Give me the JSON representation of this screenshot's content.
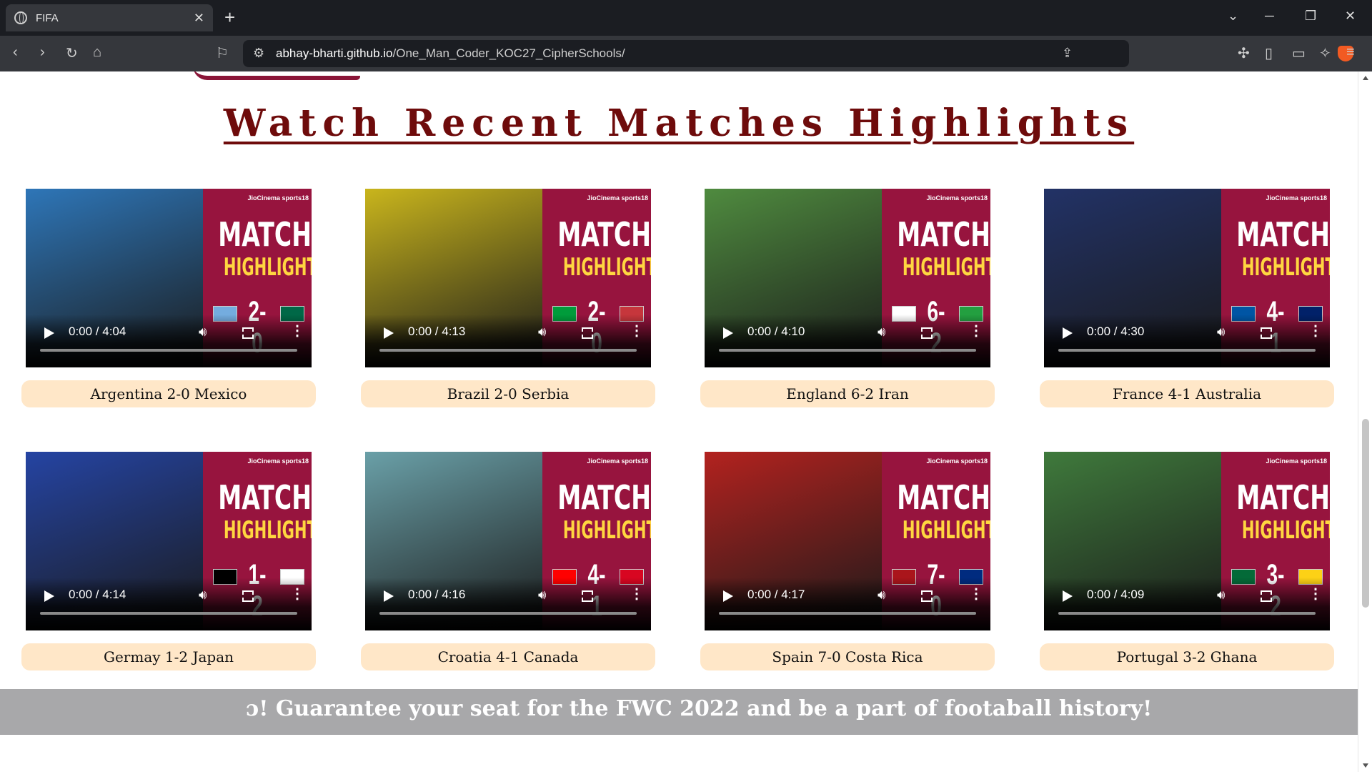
{
  "browser": {
    "tab_title": "FIFA",
    "tab_close": "✕",
    "new_tab": "+",
    "url_host": "abhay-bharti.github.io",
    "url_path": "/One_Man_Coder_KOC27_CipherSchools/"
  },
  "page": {
    "heading": "Watch Recent Matches Highlights",
    "banner": "ɔ! Guarantee your seat for the FWC 2022 and be a part of footaball history!"
  },
  "thumbnail_text": {
    "match": "MATCH",
    "highlights": "HIGHLIGHTS",
    "brand": "JioCinema  sports18"
  },
  "videos": [
    {
      "label": "Argentina 2-0 Mexico",
      "time": "0:00 / 4:04",
      "score": "2-0",
      "photo": "#2e76b8",
      "flag_left": "#74acdf",
      "flag_right": "#006847"
    },
    {
      "label": "Brazil 2-0 Serbia",
      "time": "0:00 / 4:13",
      "score": "2-0",
      "photo": "#c9b51c",
      "flag_left": "#009c3b",
      "flag_right": "#c6363c"
    },
    {
      "label": "England 6-2 Iran",
      "time": "0:00 / 4:10",
      "score": "6-2",
      "photo": "#4f8b3f",
      "flag_left": "#ffffff",
      "flag_right": "#239f40"
    },
    {
      "label": "France 4-1 Australia",
      "time": "0:00 / 4:30",
      "score": "4-1",
      "photo": "#223266",
      "flag_left": "#0055a4",
      "flag_right": "#012169"
    },
    {
      "label": "Germay 1-2 Japan",
      "time": "0:00 / 4:14",
      "score": "1-2",
      "photo": "#2544a3",
      "flag_left": "#000000",
      "flag_right": "#ffffff"
    },
    {
      "label": "Croatia 4-1 Canada",
      "time": "0:00 / 4:16",
      "score": "4-1",
      "photo": "#6aa0a8",
      "flag_left": "#ff0000",
      "flag_right": "#d80621"
    },
    {
      "label": "Spain 7-0 Costa Rica",
      "time": "0:00 / 4:17",
      "score": "7-0",
      "photo": "#b3221f",
      "flag_left": "#aa151b",
      "flag_right": "#002b7f"
    },
    {
      "label": "Portugal 3-2 Ghana",
      "time": "0:00 / 4:09",
      "score": "3-2",
      "photo": "#3f7a3c",
      "flag_left": "#046a38",
      "flag_right": "#fcd116"
    }
  ]
}
